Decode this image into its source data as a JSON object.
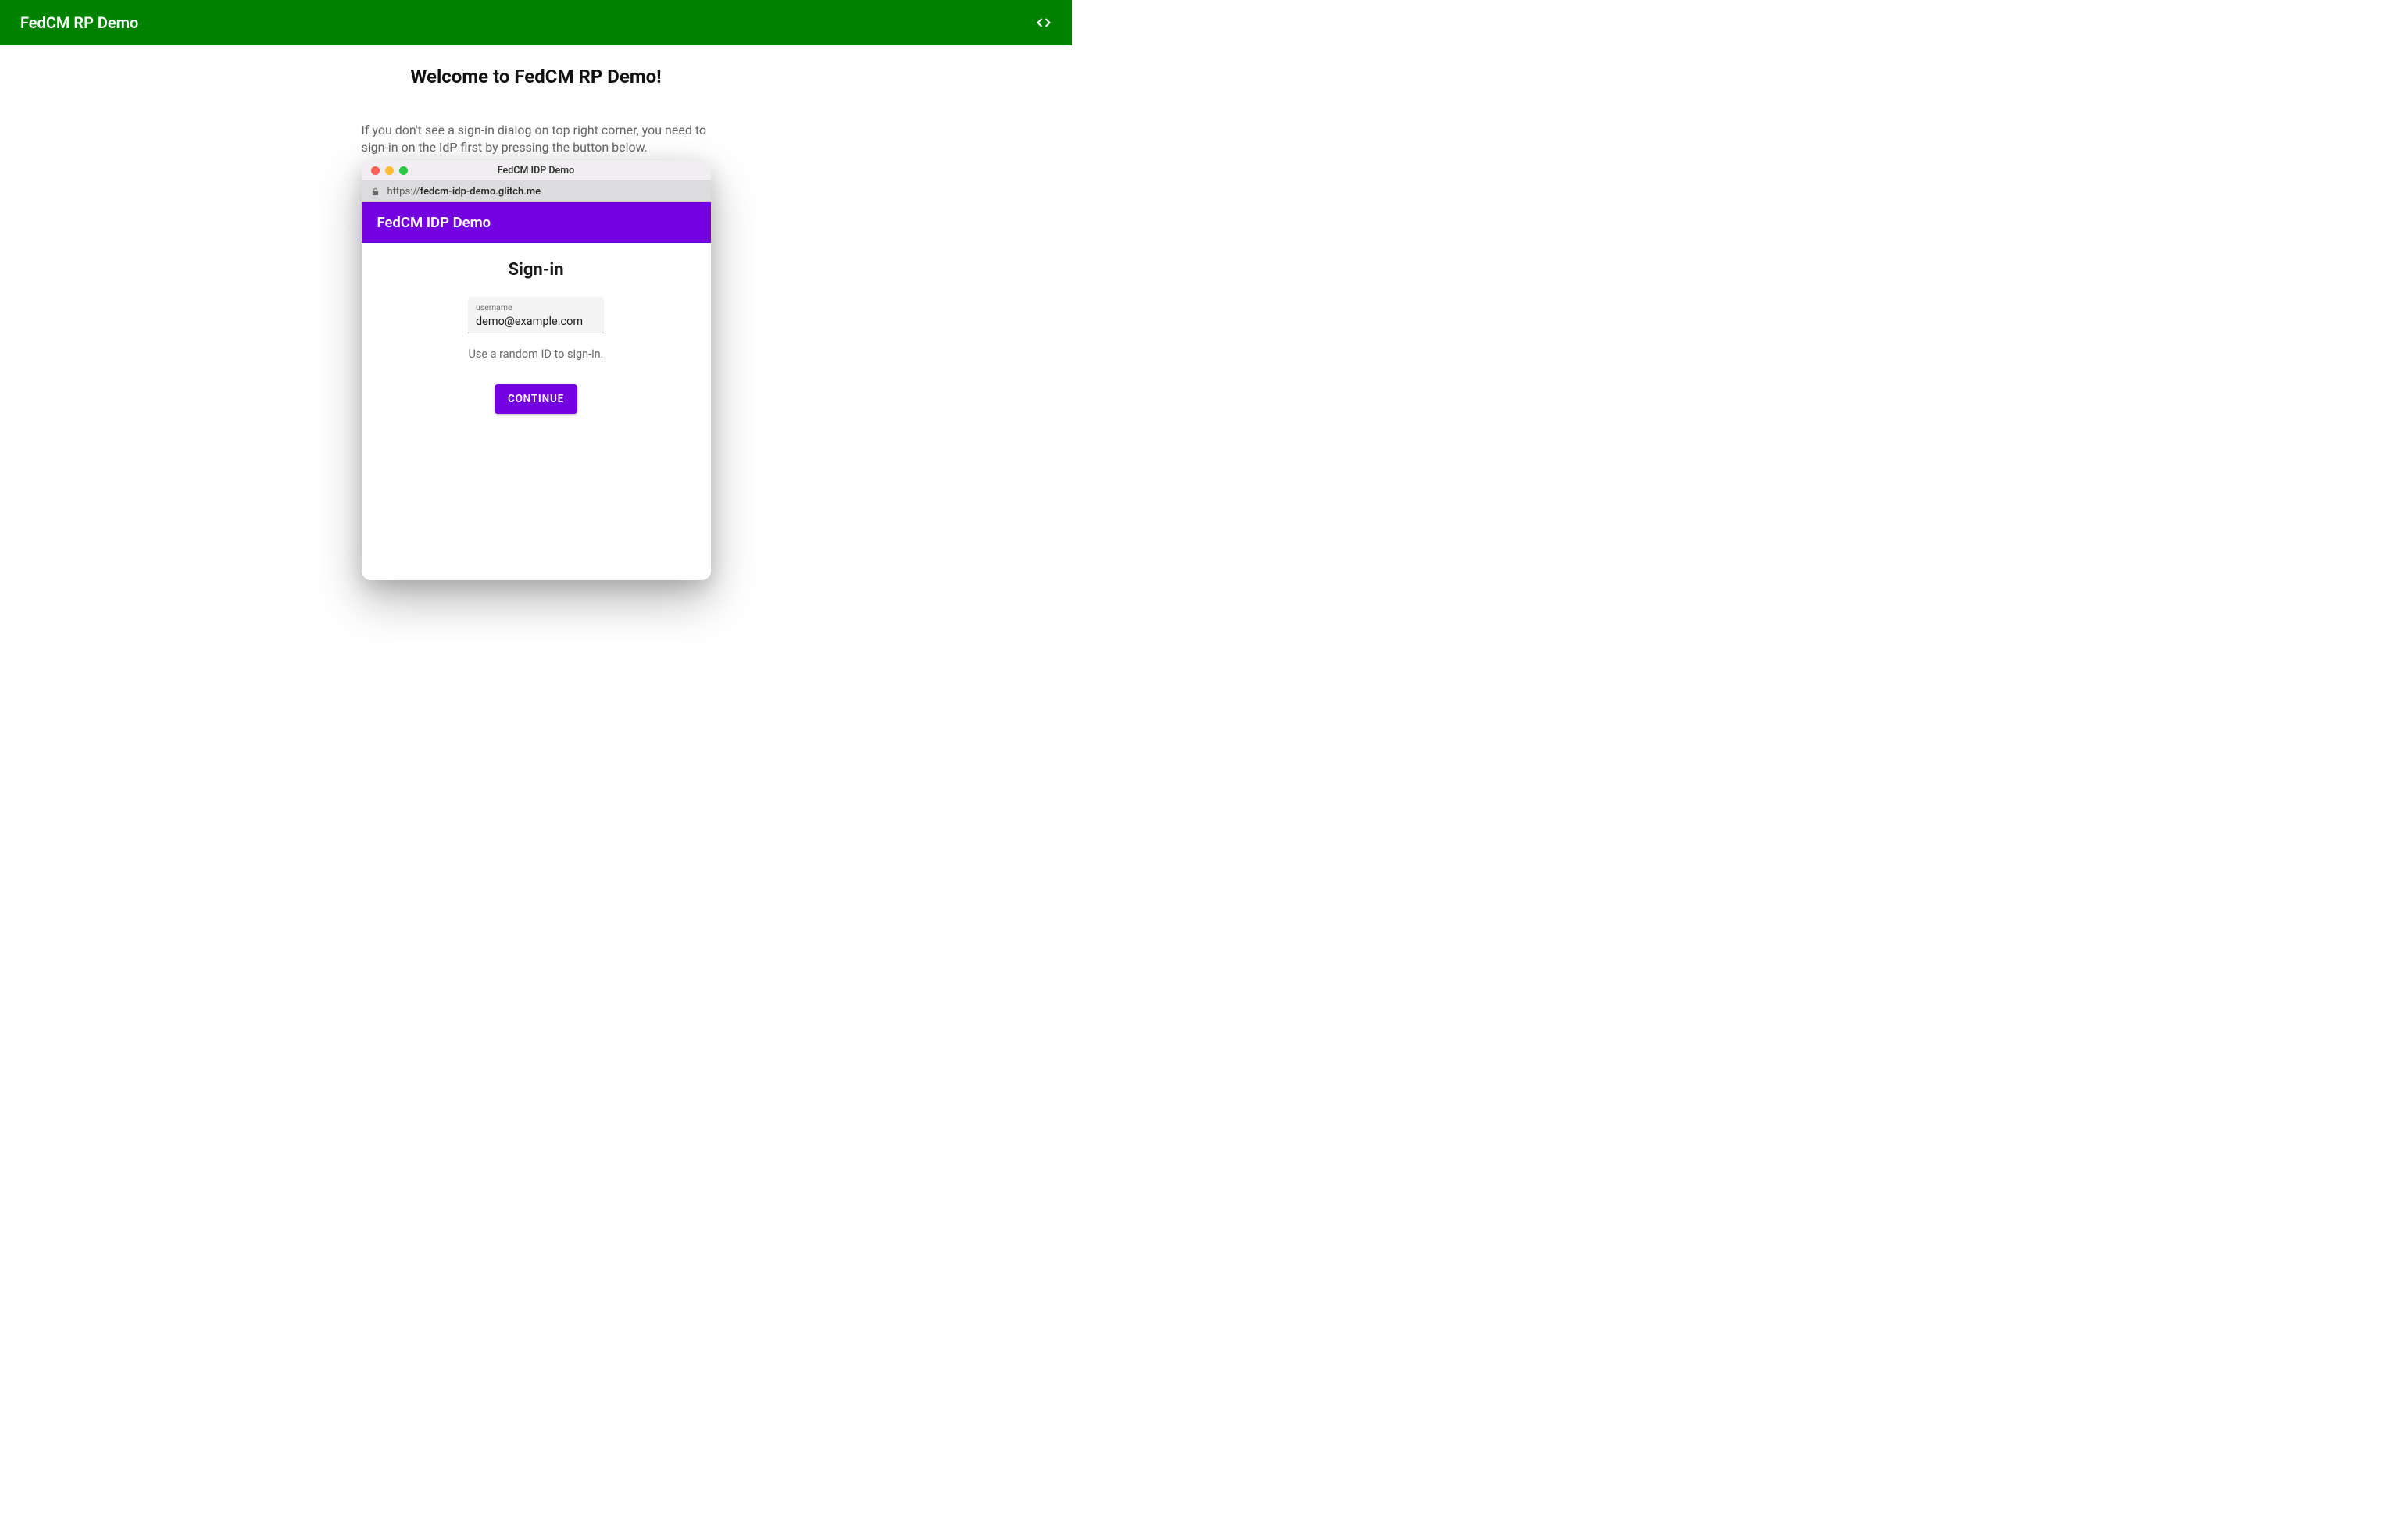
{
  "header": {
    "title": "FedCM RP Demo"
  },
  "main": {
    "heading": "Welcome to FedCM RP Demo!",
    "instruction": "If you don't see a sign-in dialog on top right corner, you need to sign-in on the IdP first by pressing the button below."
  },
  "popup": {
    "window_title": "FedCM IDP Demo",
    "url_protocol": "https://",
    "url_host": "fedcm-idp-demo.glitch.me",
    "idp_header": "FedCM IDP Demo",
    "signin_heading": "Sign-in",
    "username_label": "username",
    "username_value": "demo@example.com",
    "help_text": "Use a random ID to sign-in.",
    "continue_label": "CONTINUE"
  },
  "colors": {
    "green": "#008200",
    "purple": "#7401e0"
  }
}
